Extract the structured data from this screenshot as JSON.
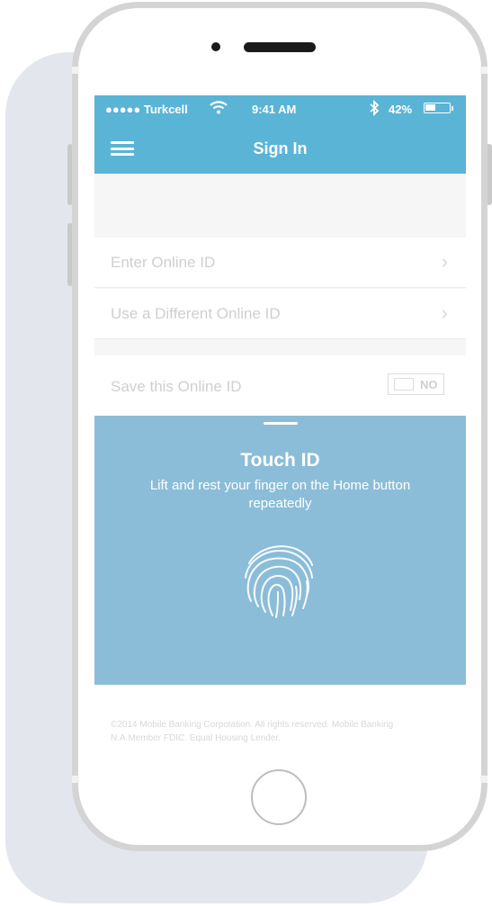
{
  "status_bar": {
    "carrier": "●●●●● Turkcell",
    "time": "9:41 AM",
    "battery_percent": "42%",
    "battery_level": 0.42,
    "wifi_icon": "wifi-icon",
    "bluetooth_icon": "bluetooth-icon"
  },
  "nav": {
    "title": "Sign In",
    "menu_icon": "hamburger-menu-icon"
  },
  "form": {
    "enter_online_id": "Enter Online ID",
    "use_different_online_id": "Use a Different Online ID",
    "save_online_id": "Save this Online ID",
    "save_toggle_value": "NO"
  },
  "touch_id": {
    "title": "Touch ID",
    "subtitle": "Lift and rest your finger on the Home button repeatedly",
    "icon": "fingerprint-icon"
  },
  "footer": {
    "copyright": "©2014 Mobile Banking Corpotation. All rights reserved. Mobile Banking N.A.Member FDIC. Equal Housing Lender."
  },
  "colors": {
    "header_blue": "#5ab4d6",
    "touch_panel_blue": "#8bbdd8"
  }
}
